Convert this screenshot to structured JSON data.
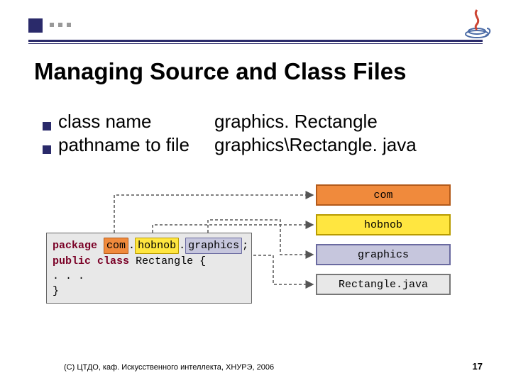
{
  "title": "Managing Source and Class Files",
  "bullets": [
    {
      "label": "class name",
      "value": "graphics. Rectangle"
    },
    {
      "label": "pathname to file",
      "value": "graphics\\Rectangle. java"
    }
  ],
  "code": {
    "kw_package": "package",
    "pkg_com": "com",
    "pkg_hobnob": "hobnob",
    "pkg_graphics": "graphics",
    "semicolon": ";",
    "kw_public": "public",
    "kw_class": "class",
    "classname": "Rectangle",
    "brace_open": "{",
    "ellipsis": ". . .",
    "brace_close": "}"
  },
  "dirs": {
    "com": "com",
    "hobnob": "hobnob",
    "graphics": "graphics",
    "file": "Rectangle.java"
  },
  "footer": "(С) ЦТДО, каф. Искусственного интеллекта, ХНУРЭ, 2006",
  "page": "17"
}
